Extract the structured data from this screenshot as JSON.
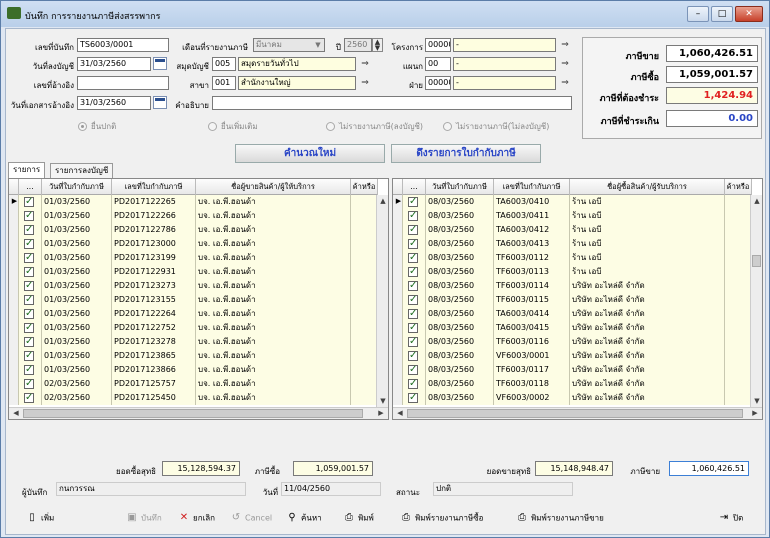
{
  "window": {
    "title": "บันทึก การรายงานภาษีส่งสรรพากร",
    "min": "–",
    "max": "□",
    "close": "✕"
  },
  "form": {
    "doc_no_label": "เลขที่บันทึก",
    "doc_no": "TS6003/0001",
    "report_month_label": "เดือนที่รายงานภาษี",
    "report_month": "มีนาคม",
    "year_label": "ปี",
    "year": "2560",
    "project_label": "โครงการ",
    "project_code": "00000",
    "project_name": "-",
    "post_date_label": "วันที่ลงบัญชี",
    "post_date": "31/03/2560",
    "journal_label": "สมุดบัญชี",
    "journal_code": "005",
    "journal_name": "สมุดรายวันทั่วไป",
    "dept_label": "แผนก",
    "dept_code": "00",
    "dept_name": "-",
    "ref_no_label": "เลขที่อ้างอิง",
    "ref_no": "",
    "branch_label": "สาขา",
    "branch_code": "001",
    "branch_name": "สำนักงานใหญ่",
    "division_label": "ฝ่าย",
    "division_code": "00000",
    "division_name": "-",
    "ref_date_label": "วันที่เอกสารอ้างอิง",
    "ref_date": "31/03/2560",
    "desc_label": "คำอธิบาย",
    "desc": ""
  },
  "radios": [
    "ยื่นปกติ",
    "ยื่นเพิ่มเติม",
    "ไม่รายงานภาษี(ลงบัญชี)",
    "ไม่รายงานภาษี(ไม่ลงบัญชี)"
  ],
  "tax": {
    "sales_label": "ภาษีขาย",
    "sales": "1,060,426.51",
    "purchase_label": "ภาษีซื้อ",
    "purchase": "1,059,001.57",
    "payable_label": "ภาษีที่ต้องชำระ",
    "payable": "1,424.94",
    "overpaid_label": "ภาษีที่ชำระเกิน",
    "overpaid": "0.00"
  },
  "actions": {
    "recalc": "คำนวณใหม่",
    "fetch": "ดึงรายการใบกำกับภาษี"
  },
  "tabs": [
    "รายการ",
    "รายการลงบัญชี"
  ],
  "left_grid": {
    "headers": [
      "...",
      "วันที่ใบกำกับภาษี",
      "เลขที่ใบกำกับภาษี",
      "ชื่อผู้ขายสินค้า/ผู้ให้บริการ",
      "ค้าหรือ"
    ],
    "rows": [
      [
        "01/03/2560",
        "PD2017122265",
        "บจ. เอ.พี.ฮอนด้า"
      ],
      [
        "01/03/2560",
        "PD2017122266",
        "บจ. เอ.พี.ฮอนด้า"
      ],
      [
        "01/03/2560",
        "PD2017122786",
        "บจ. เอ.พี.ฮอนด้า"
      ],
      [
        "01/03/2560",
        "PD2017123000",
        "บจ. เอ.พี.ฮอนด้า"
      ],
      [
        "01/03/2560",
        "PD2017123199",
        "บจ. เอ.พี.ฮอนด้า"
      ],
      [
        "01/03/2560",
        "PD2017122931",
        "บจ. เอ.พี.ฮอนด้า"
      ],
      [
        "01/03/2560",
        "PD2017123273",
        "บจ. เอ.พี.ฮอนด้า"
      ],
      [
        "01/03/2560",
        "PD2017123155",
        "บจ. เอ.พี.ฮอนด้า"
      ],
      [
        "01/03/2560",
        "PD2017122264",
        "บจ. เอ.พี.ฮอนด้า"
      ],
      [
        "01/03/2560",
        "PD2017122752",
        "บจ. เอ.พี.ฮอนด้า"
      ],
      [
        "01/03/2560",
        "PD2017123278",
        "บจ. เอ.พี.ฮอนด้า"
      ],
      [
        "01/03/2560",
        "PD2017123865",
        "บจ. เอ.พี.ฮอนด้า"
      ],
      [
        "01/03/2560",
        "PD2017123866",
        "บจ. เอ.พี.ฮอนด้า"
      ],
      [
        "02/03/2560",
        "PD2017125757",
        "บจ. เอ.พี.ฮอนด้า"
      ],
      [
        "02/03/2560",
        "PD2017125450",
        "บจ. เอ.พี.ฮอนด้า"
      ]
    ]
  },
  "right_grid": {
    "headers": [
      "...",
      "วันที่ใบกำกับภาษี",
      "เลขที่ใบกำกับภาษี",
      "ชื่อผู้ซื้อสินค้า/ผู้รับบริการ",
      "ค้าหรือ"
    ],
    "rows": [
      [
        "08/03/2560",
        "TA6003/0410",
        "ร้าน เอบี"
      ],
      [
        "08/03/2560",
        "TA6003/0411",
        "ร้าน เอบี"
      ],
      [
        "08/03/2560",
        "TA6003/0412",
        "ร้าน เอบี"
      ],
      [
        "08/03/2560",
        "TA6003/0413",
        "ร้าน เอบี"
      ],
      [
        "08/03/2560",
        "TF6003/0112",
        "ร้าน เอบี"
      ],
      [
        "08/03/2560",
        "TF6003/0113",
        "ร้าน เอบี"
      ],
      [
        "08/03/2560",
        "TF6003/0114",
        "บริษัท อะไหล่ดี จำกัด"
      ],
      [
        "08/03/2560",
        "TF6003/0115",
        "บริษัท อะไหล่ดี จำกัด"
      ],
      [
        "08/03/2560",
        "TA6003/0414",
        "บริษัท อะไหล่ดี จำกัด"
      ],
      [
        "08/03/2560",
        "TA6003/0415",
        "บริษัท อะไหล่ดี จำกัด"
      ],
      [
        "08/03/2560",
        "TF6003/0116",
        "บริษัท อะไหล่ดี จำกัด"
      ],
      [
        "08/03/2560",
        "VF6003/0001",
        "บริษัท อะไหล่ดี จำกัด"
      ],
      [
        "08/03/2560",
        "TF6003/0117",
        "บริษัท อะไหล่ดี จำกัด"
      ],
      [
        "08/03/2560",
        "TF6003/0118",
        "บริษัท อะไหล่ดี จำกัด"
      ],
      [
        "08/03/2560",
        "VF6003/0002",
        "บริษัท อะไหล่ดี จำกัด"
      ]
    ]
  },
  "summary": {
    "net_purchase_label": "ยอดซื้อสุทธิ",
    "net_purchase": "15,128,594.37",
    "purchase_tax_label": "ภาษีซื้อ",
    "purchase_tax": "1,059,001.57",
    "net_sales_label": "ยอดขายสุทธิ",
    "net_sales": "15,148,948.47",
    "sales_tax_label": "ภาษีขาย",
    "sales_tax": "1,060,426.51"
  },
  "footer": {
    "recorder_label": "ผู้บันทึก",
    "recorder": "กนกวรรณ",
    "date_label": "วันที่",
    "date": "11/04/2560",
    "status_label": "สถานะ",
    "status": "ปกติ"
  },
  "toolbar": {
    "add": "เพิ่ม",
    "save": "บันทึก",
    "cancel_doc": "ยกเลิก",
    "cancel": "Cancel",
    "find": "ค้นหา",
    "print": "พิมพ์",
    "print_purchase": "พิมพ์รายงานภาษีซื้อ",
    "print_sales": "พิมพ์รายงานภาษีขาย",
    "close": "ปิด"
  }
}
